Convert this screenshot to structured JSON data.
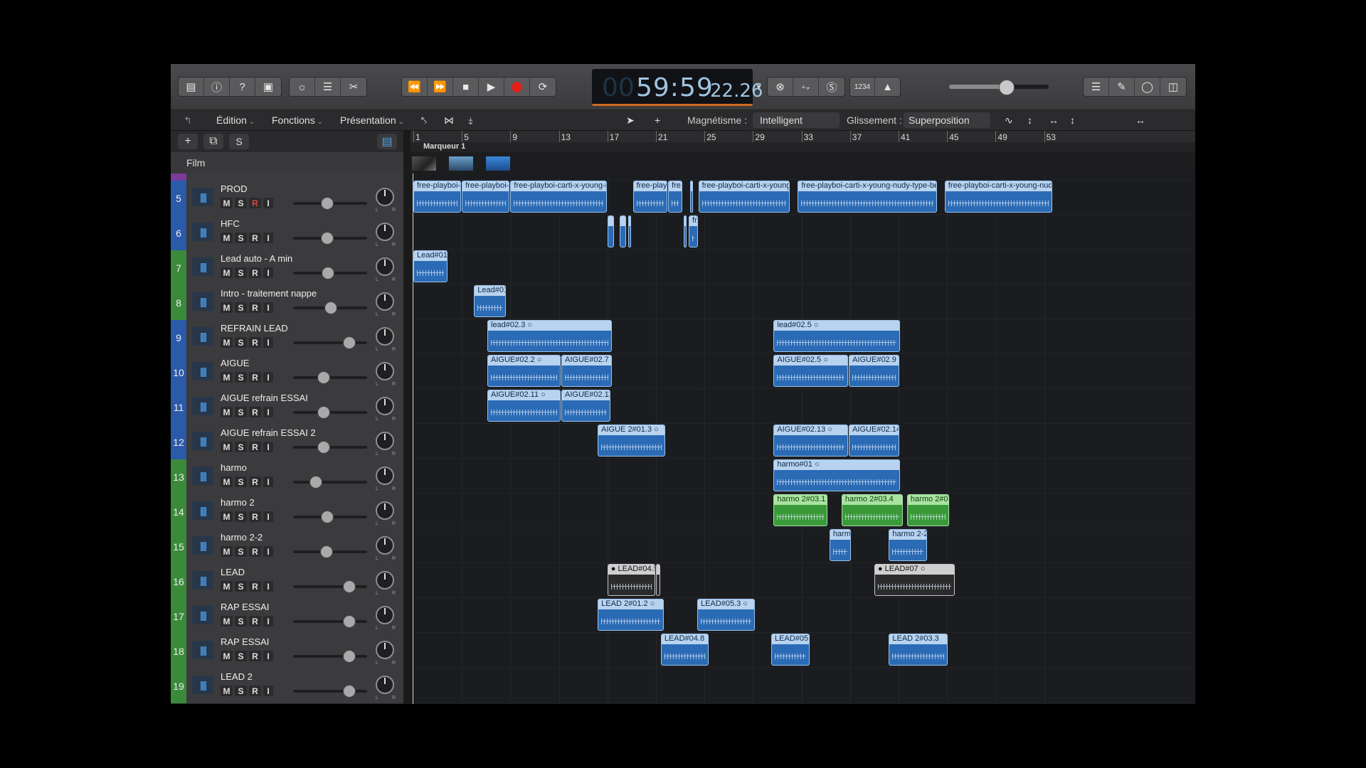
{
  "transport": {
    "lcd_dim": "00",
    "lcd_main": "59:59",
    "lcd_small": "22.26",
    "meter_key": "1234",
    "volume_level": 0.57
  },
  "menu": {
    "edit": "Édition",
    "functions": "Fonctions",
    "view": "Présentation",
    "snap_label": "Magnétisme :",
    "snap_value": "Intelligent",
    "drag_label": "Glissement :",
    "drag_value": "Superposition"
  },
  "left_toolbar": {
    "add": "+",
    "s_button": "S"
  },
  "film_header": "Film",
  "marker": "Marqueur 1",
  "ruler_ticks": [
    "1",
    "5",
    "9",
    "13",
    "17",
    "21",
    "25",
    "29",
    "33",
    "37",
    "41",
    "45",
    "49",
    "53"
  ],
  "track_buttons": {
    "m": "M",
    "s": "S",
    "r": "R",
    "i": "I"
  },
  "pan_labels": {
    "l": "L",
    "r": "R"
  },
  "tracks": [
    {
      "num": "5",
      "name": "PROD",
      "color": "#2a5aa8",
      "vol": 0.45,
      "rec": true
    },
    {
      "num": "6",
      "name": "HFC",
      "color": "#2a5aa8",
      "vol": 0.45,
      "rec": false
    },
    {
      "num": "7",
      "name": "Lead auto - A min",
      "color": "#3a8a3a",
      "vol": 0.46,
      "rec": false
    },
    {
      "num": "8",
      "name": "Intro - traitement nappe",
      "color": "#3a8a3a",
      "vol": 0.5,
      "rec": false
    },
    {
      "num": "9",
      "name": "REFRAIN LEAD",
      "color": "#2a5aa8",
      "vol": 0.75,
      "rec": false
    },
    {
      "num": "10",
      "name": "AIGUE",
      "color": "#2a5aa8",
      "vol": 0.4,
      "rec": false
    },
    {
      "num": "11",
      "name": "AIGUE refrain ESSAI",
      "color": "#2a5aa8",
      "vol": 0.4,
      "rec": false
    },
    {
      "num": "12",
      "name": "AIGUE refrain ESSAI 2",
      "color": "#2a5aa8",
      "vol": 0.4,
      "rec": false
    },
    {
      "num": "13",
      "name": "harmo",
      "color": "#3a8a3a",
      "vol": 0.3,
      "rec": false
    },
    {
      "num": "14",
      "name": "harmo 2",
      "color": "#3a8a3a",
      "vol": 0.45,
      "rec": false
    },
    {
      "num": "15",
      "name": "harmo 2-2",
      "color": "#3a8a3a",
      "vol": 0.44,
      "rec": false
    },
    {
      "num": "16",
      "name": "LEAD",
      "color": "#3a8a3a",
      "vol": 0.75,
      "rec": false
    },
    {
      "num": "17",
      "name": "RAP ESSAI",
      "color": "#3a8a3a",
      "vol": 0.75,
      "rec": false
    },
    {
      "num": "18",
      "name": "RAP ESSAI",
      "color": "#3a8a3a",
      "vol": 0.75,
      "rec": false
    },
    {
      "num": "19",
      "name": "LEAD 2",
      "color": "#3a8a3a",
      "vol": 0.75,
      "rec": false
    }
  ],
  "regions": [
    {
      "t": 0,
      "s": 1,
      "e": 5,
      "n": "free-playboi-c",
      "k": "b"
    },
    {
      "t": 0,
      "s": 5,
      "e": 9,
      "n": "free-playboi-c",
      "k": "b"
    },
    {
      "t": 0,
      "s": 9,
      "e": 17,
      "n": "free-playboi-carti-x-young-nu",
      "k": "b"
    },
    {
      "t": 0,
      "s": 19.1,
      "e": 22,
      "n": "free-playb",
      "k": "b"
    },
    {
      "t": 0,
      "s": 22,
      "e": 23.2,
      "n": "fre",
      "k": "b"
    },
    {
      "t": 0,
      "s": 23.8,
      "e": 24.1,
      "n": "",
      "k": "b"
    },
    {
      "t": 0,
      "s": 24.5,
      "e": 32.1,
      "n": "free-playboi-carti-x-young",
      "k": "b"
    },
    {
      "t": 0,
      "s": 32.7,
      "e": 44.2,
      "n": "free-playboi-carti-x-young-nudy-type-beat",
      "k": "b"
    },
    {
      "t": 0,
      "s": 44.8,
      "e": 53.7,
      "n": "free-playboi-carti-x-young-nudy-",
      "k": "b"
    },
    {
      "t": 1,
      "s": 17,
      "e": 17.6,
      "n": "",
      "k": "b"
    },
    {
      "t": 1,
      "s": 18,
      "e": 18.6,
      "n": "",
      "k": "b"
    },
    {
      "t": 1,
      "s": 18.7,
      "e": 19,
      "n": "",
      "k": "b"
    },
    {
      "t": 1,
      "s": 23.3,
      "e": 23.6,
      "n": "",
      "k": "b"
    },
    {
      "t": 1,
      "s": 23.7,
      "e": 24.5,
      "n": "fr",
      "k": "b"
    },
    {
      "t": 2,
      "s": 1,
      "e": 3.9,
      "n": "Lead#01.3",
      "k": "b"
    },
    {
      "t": 3,
      "s": 6,
      "e": 8.7,
      "n": "Lead#01.",
      "k": "b"
    },
    {
      "t": 4,
      "s": 7.1,
      "e": 17.4,
      "n": "lead#02.3",
      "k": "b",
      "o": true
    },
    {
      "t": 4,
      "s": 30.7,
      "e": 41.2,
      "n": "lead#02.5",
      "k": "b",
      "o": true
    },
    {
      "t": 5,
      "s": 7.1,
      "e": 13.2,
      "n": "AIGUE#02.2",
      "k": "b",
      "o": true
    },
    {
      "t": 5,
      "s": 13.2,
      "e": 17.4,
      "n": "AIGUE#02.7",
      "k": "b"
    },
    {
      "t": 5,
      "s": 30.7,
      "e": 36.9,
      "n": "AIGUE#02.5",
      "k": "b",
      "o": true
    },
    {
      "t": 5,
      "s": 36.9,
      "e": 41.1,
      "n": "AIGUE#02.9",
      "k": "b"
    },
    {
      "t": 6,
      "s": 7.1,
      "e": 13.2,
      "n": "AIGUE#02.11",
      "k": "b",
      "o": true
    },
    {
      "t": 6,
      "s": 13.2,
      "e": 17.3,
      "n": "AIGUE#02.12",
      "k": "b"
    },
    {
      "t": 7,
      "s": 16.2,
      "e": 21.8,
      "n": "AIGUE 2#01.3",
      "k": "b",
      "o": true
    },
    {
      "t": 7,
      "s": 30.7,
      "e": 36.9,
      "n": "AIGUE#02.13",
      "k": "b",
      "o": true
    },
    {
      "t": 7,
      "s": 36.9,
      "e": 41.1,
      "n": "AIGUE#02.14",
      "k": "b"
    },
    {
      "t": 8,
      "s": 30.7,
      "e": 41.2,
      "n": "harmo#01",
      "k": "b",
      "o": true
    },
    {
      "t": 9,
      "s": 30.7,
      "e": 35.2,
      "n": "harmo 2#03.1",
      "k": "g"
    },
    {
      "t": 9,
      "s": 36.3,
      "e": 41.4,
      "n": "harmo 2#03.4",
      "k": "g"
    },
    {
      "t": 9,
      "s": 41.7,
      "e": 45.2,
      "n": "harmo 2#05",
      "k": "g"
    },
    {
      "t": 10,
      "s": 35.3,
      "e": 37.1,
      "n": "harm",
      "k": "b"
    },
    {
      "t": 10,
      "s": 40.2,
      "e": 43.4,
      "n": "harmo 2-2",
      "k": "b"
    },
    {
      "t": 11,
      "s": 17,
      "e": 21,
      "n": "LEAD#04.5",
      "k": "gr",
      "d": true
    },
    {
      "t": 11,
      "s": 21,
      "e": 21.4,
      "n": "",
      "k": "gr"
    },
    {
      "t": 11,
      "s": 39,
      "e": 45.7,
      "n": "LEAD#07",
      "k": "gr",
      "d": true,
      "o": true
    },
    {
      "t": 12,
      "s": 16.2,
      "e": 21.7,
      "n": "LEAD 2#01.2",
      "k": "b",
      "o": true
    },
    {
      "t": 12,
      "s": 24.4,
      "e": 29.2,
      "n": "LEAD#05.3",
      "k": "b",
      "o": true
    },
    {
      "t": 13,
      "s": 21.4,
      "e": 25.4,
      "n": "LEAD#04.8",
      "k": "b"
    },
    {
      "t": 13,
      "s": 30.5,
      "e": 33.7,
      "n": "LEAD#05.6",
      "k": "b"
    },
    {
      "t": 13,
      "s": 40.2,
      "e": 45.1,
      "n": "LEAD 2#03.3",
      "k": "b"
    }
  ]
}
